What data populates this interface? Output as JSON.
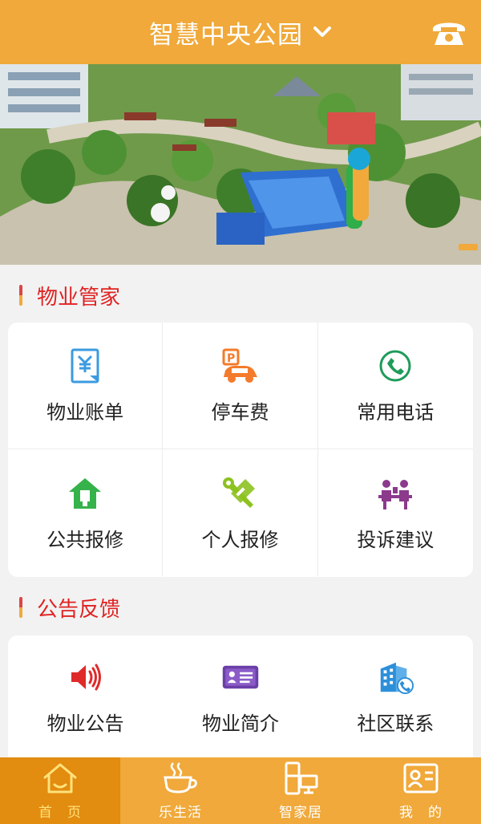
{
  "header": {
    "title": "智慧中央公园"
  },
  "sections": [
    {
      "title": "物业管家"
    },
    {
      "title": "公告反馈"
    }
  ],
  "property_items": [
    {
      "label": "物业账单",
      "icon": "bill-icon"
    },
    {
      "label": "停车费",
      "icon": "parking-car-icon"
    },
    {
      "label": "常用电话",
      "icon": "phone-circle-icon"
    },
    {
      "label": "公共报修",
      "icon": "house-wrench-icon"
    },
    {
      "label": "个人报修",
      "icon": "tools-icon"
    },
    {
      "label": "投诉建议",
      "icon": "complaint-people-icon"
    }
  ],
  "notice_items": [
    {
      "label": "物业公告",
      "icon": "speaker-icon"
    },
    {
      "label": "物业简介",
      "icon": "id-card-icon"
    },
    {
      "label": "社区联系",
      "icon": "building-phone-icon"
    }
  ],
  "tabs": [
    {
      "label": "首　页",
      "icon": "home-icon",
      "active": true
    },
    {
      "label": "乐生活",
      "icon": "coffee-cup-icon",
      "active": false
    },
    {
      "label": "智家居",
      "icon": "smart-devices-icon",
      "active": false
    },
    {
      "label": "我　的",
      "icon": "profile-card-icon",
      "active": false
    }
  ],
  "colors": {
    "header_bg": "#f0a93a",
    "section_title": "#e02222",
    "active_tab_bg": "#e28c10",
    "active_tab_label": "#ffe27a"
  }
}
